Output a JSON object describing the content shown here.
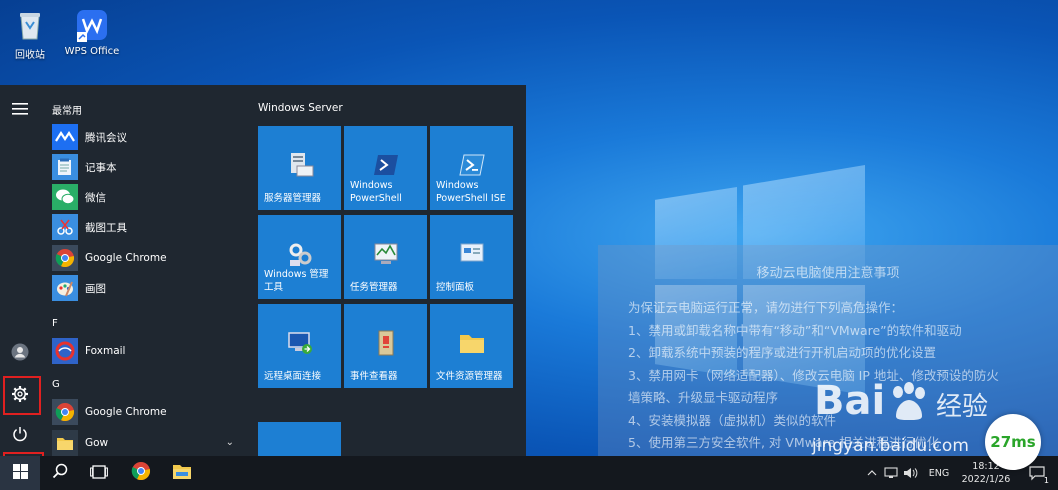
{
  "desktop": {
    "icons": [
      {
        "label": "回收站",
        "icon": "recycle-bin-icon"
      },
      {
        "label": "WPS Office",
        "icon": "wps-office-icon"
      }
    ]
  },
  "notice": {
    "title": "移动云电脑使用注意事项",
    "lines": [
      "为保证云电脑运行正常，请勿进行下列高危操作：",
      "1、禁用或卸载名称中带有“移动”和“VMware”的软件和驱动",
      "2、卸载系统中预装的程序或进行开机启动项的优化设置",
      "3、禁用网卡（网络适配器）、修改云电脑 IP 地址、修改预设的防火",
      "墙策略、升级显卡驱动程序",
      "4、安装模拟器（虚拟机）类似的软件",
      "5、使用第三方安全软件, 对 VMware 相关进程进行优化"
    ]
  },
  "start_menu": {
    "section_most_used": "最常用",
    "section_f": "F",
    "section_g": "G",
    "apps_most_used": [
      {
        "label": "腾讯会议",
        "icon": "tencent-meeting-icon"
      },
      {
        "label": "记事本",
        "icon": "notepad-icon"
      },
      {
        "label": "微信",
        "icon": "wechat-icon"
      },
      {
        "label": "截图工具",
        "icon": "snipping-tool-icon"
      },
      {
        "label": "Google Chrome",
        "icon": "chrome-icon"
      },
      {
        "label": "画图",
        "icon": "paint-icon"
      }
    ],
    "apps_f": [
      {
        "label": "Foxmail",
        "icon": "foxmail-icon"
      }
    ],
    "apps_g": [
      {
        "label": "Google Chrome",
        "icon": "chrome-icon"
      },
      {
        "label": "Gow",
        "icon": "folder-icon"
      }
    ],
    "tiles_group_title": "Windows Server",
    "tiles": [
      {
        "label": "服务器管理器",
        "icon": "server-manager-icon"
      },
      {
        "label": "Windows PowerShell",
        "label_line1": "Windows",
        "label_line2": "PowerShell",
        "icon": "powershell-icon"
      },
      {
        "label": "Windows PowerShell ISE",
        "label_line1": "Windows",
        "label_line2": "PowerShell ISE",
        "icon": "powershell-ise-icon"
      },
      {
        "label": "Windows 管理工具",
        "label_line1": "Windows 管理",
        "label_line2": "工具",
        "icon": "admin-tools-icon"
      },
      {
        "label": "任务管理器",
        "icon": "task-manager-icon"
      },
      {
        "label": "控制面板",
        "icon": "control-panel-icon"
      },
      {
        "label": "远程桌面连接",
        "icon": "remote-desktop-icon"
      },
      {
        "label": "事件查看器",
        "icon": "event-viewer-icon"
      },
      {
        "label": "文件资源管理器",
        "icon": "file-explorer-icon"
      }
    ],
    "rail": [
      "hamburger-menu-icon",
      "user-avatar-icon",
      "settings-gear-icon",
      "power-icon"
    ]
  },
  "taskbar": {
    "items": [
      "windows-start-icon",
      "search-icon",
      "task-view-icon",
      "chrome-icon",
      "file-explorer-icon"
    ],
    "tray_language": "ENG",
    "clock_time": "18:12",
    "clock_date": "2022/1/26",
    "notification_count": "1"
  },
  "watermark": {
    "logo_text": "Bai",
    "logo_text2": "经验",
    "url": "jingyan.baidu.com",
    "ms": "27ms"
  },
  "colors": {
    "start_bg": "#1f2730",
    "tile_bg": "#1d7fd3",
    "taskbar_bg": "#14181e",
    "highlight_box": "#e02020"
  }
}
